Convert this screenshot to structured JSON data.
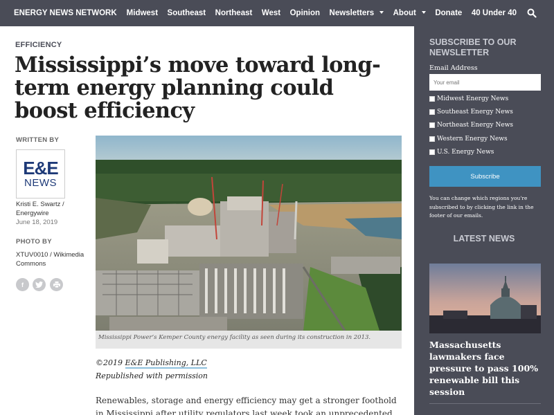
{
  "nav": {
    "brand": "ENERGY NEWS NETWORK",
    "items": [
      "Midwest",
      "Southeast",
      "Northeast",
      "West",
      "Opinion"
    ],
    "newsletters": "Newsletters",
    "about": "About",
    "donate": "Donate",
    "forty": "40 Under 40",
    "search_icon": "search-icon"
  },
  "article": {
    "kicker": "EFFICIENCY",
    "headline": "Mississippi’s move toward long-term energy planning could boost efficiency",
    "written_by_label": "WRITTEN BY",
    "logo_top": "E&E",
    "logo_bottom": "NEWS",
    "author": "Kristi E. Swartz / Energywire",
    "date": "June 18, 2019",
    "photo_by_label": "PHOTO BY",
    "photographer": "XTUV0010 / Wikimedia Commons",
    "caption": "Mississippi Power’s Kemper County energy facility as seen during its construction in 2013.",
    "copyright_prefix": "©2019 ",
    "copyright_link": "E&E Publishing, LLC",
    "republished": "Republished with permission",
    "body": "Renewables, storage and energy efficiency may get a stronger foothold in Mississippi after utility regulators last week took an unprecedented move to"
  },
  "share": {
    "facebook": "f",
    "twitter": "twitter-icon",
    "print": "print-icon"
  },
  "sidebar": {
    "subscribe_title": "SUBSCRIBE TO OUR NEWSLETTER",
    "email_label": "Email Address",
    "email_placeholder": "Your email",
    "options": [
      "Midwest Energy News",
      "Southeast Energy News",
      "Northeast Energy News",
      "Western Energy News",
      "U.S. Energy News"
    ],
    "subscribe_button": "Subscribe",
    "note": "You can change which regions you're subscribed to by clicking the link in the footer of our emails.",
    "latest_title": "LATEST NEWS",
    "latest_headline": "Massachusetts lawmakers face pressure to pass 100% renewable bill this session"
  }
}
